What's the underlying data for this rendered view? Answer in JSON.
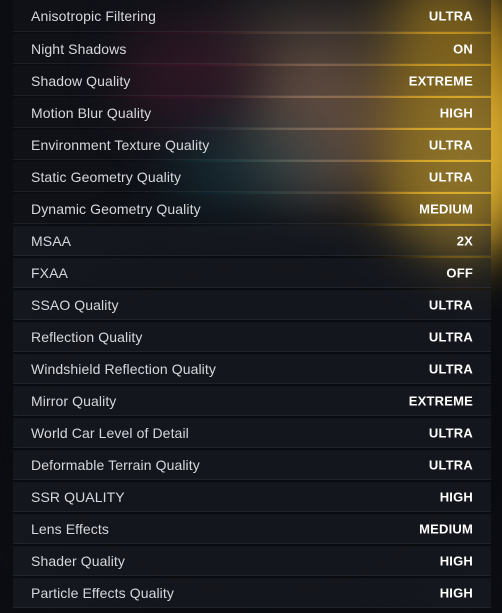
{
  "settings": [
    {
      "label": "Anisotropic Filtering",
      "value": "ULTRA"
    },
    {
      "label": "Night Shadows",
      "value": "ON"
    },
    {
      "label": "Shadow Quality",
      "value": "EXTREME"
    },
    {
      "label": "Motion Blur Quality",
      "value": "HIGH"
    },
    {
      "label": "Environment Texture Quality",
      "value": "ULTRA"
    },
    {
      "label": "Static Geometry Quality",
      "value": "ULTRA"
    },
    {
      "label": "Dynamic Geometry Quality",
      "value": "MEDIUM"
    },
    {
      "label": "MSAA",
      "value": "2X"
    },
    {
      "label": "FXAA",
      "value": "OFF"
    },
    {
      "label": "SSAO Quality",
      "value": "ULTRA"
    },
    {
      "label": "Reflection Quality",
      "value": "ULTRA"
    },
    {
      "label": "Windshield Reflection Quality",
      "value": "ULTRA"
    },
    {
      "label": "Mirror Quality",
      "value": "EXTREME"
    },
    {
      "label": "World Car Level of Detail",
      "value": "ULTRA"
    },
    {
      "label": "Deformable Terrain Quality",
      "value": "ULTRA"
    },
    {
      "label": "SSR QUALITY",
      "value": "HIGH"
    },
    {
      "label": "Lens Effects",
      "value": "MEDIUM"
    },
    {
      "label": "Shader Quality",
      "value": "HIGH"
    },
    {
      "label": "Particle Effects Quality",
      "value": "HIGH"
    }
  ]
}
